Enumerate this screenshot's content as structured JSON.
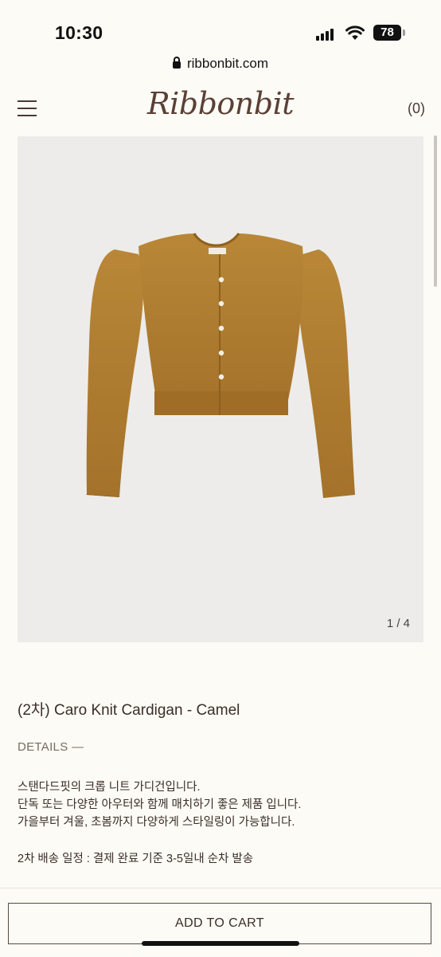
{
  "status": {
    "time": "10:30",
    "battery": "78"
  },
  "browser": {
    "url": "ribbonbit.com"
  },
  "header": {
    "logo": "Ribbonbit",
    "cart_count": "(0)"
  },
  "gallery": {
    "counter": "1 / 4",
    "product_color": "#b07d32"
  },
  "product": {
    "title": "(2차) Caro Knit Cardigan - Camel",
    "details_label": "DETAILS —",
    "description": [
      "스탠다드핏의 크롭 니트 가디건입니다.",
      "단독 또는 다양한 아우터와 함께 매치하기 좋은 제품 입니다.",
      "가을부터 겨울, 초봄까지 다양하게 스타일링이 가능합니다."
    ],
    "shipping": "2차 배송 일정 : 결제 완료 기준 3-5일내 순차 발송"
  },
  "actions": {
    "add_to_cart": "ADD TO CART"
  }
}
